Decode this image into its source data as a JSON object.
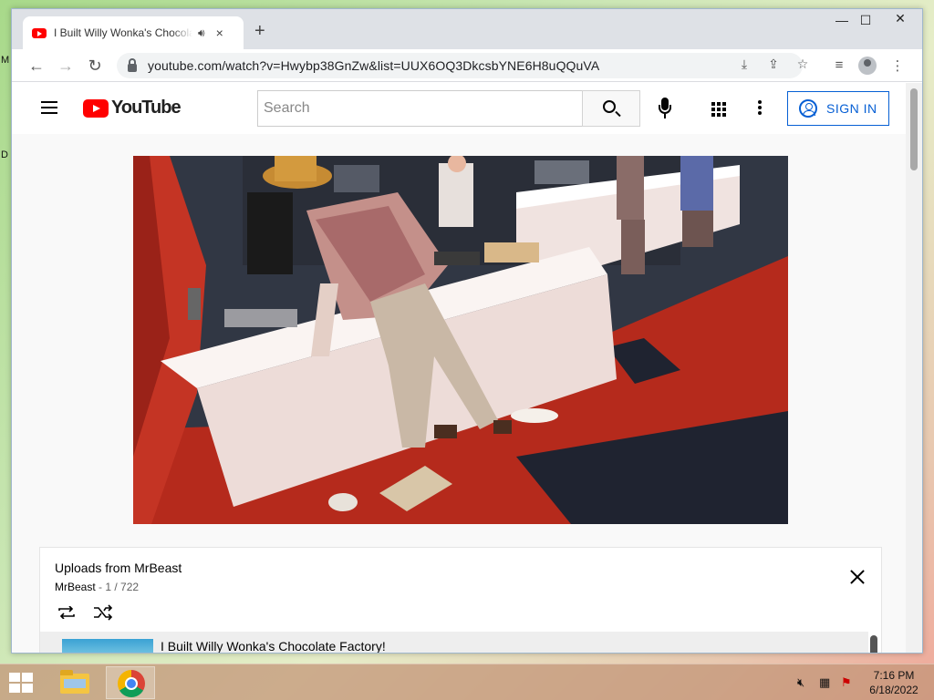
{
  "desktop": {
    "letters": [
      "M",
      "D"
    ]
  },
  "browser": {
    "tab": {
      "title": "I Built Willy Wonka's Chocolate Factory!",
      "audio_icon": "speaker-icon",
      "close_glyph": "×"
    },
    "new_tab_glyph": "+",
    "window_controls": {
      "minimize": "—",
      "maximize": "☐",
      "close": "✕"
    },
    "nav": {
      "back": "←",
      "forward": "→",
      "reload": "↻"
    },
    "url": "youtube.com/watch?v=Hwybp38GnZw&list=UUX6OQ3DkcsbYNE6H8uQQuVA",
    "toolbar_icons": [
      "install-icon",
      "share-icon",
      "star-icon",
      "media-control-icon",
      "profile-icon",
      "menu-icon"
    ]
  },
  "youtube": {
    "logo_text": "YouTube",
    "search": {
      "placeholder": "Search"
    },
    "sign_in_label": "SIGN IN"
  },
  "playlist": {
    "title": "Uploads from MrBeast",
    "owner": "MrBeast",
    "position": " - 1 / 722",
    "items": [
      {
        "title": "I Built Willy Wonka's Chocolate Factory!"
      }
    ]
  },
  "taskbar": {
    "apps": [
      "file-explorer-icon",
      "chrome-icon"
    ],
    "time": "7:16 PM",
    "date": "6/18/2022"
  }
}
